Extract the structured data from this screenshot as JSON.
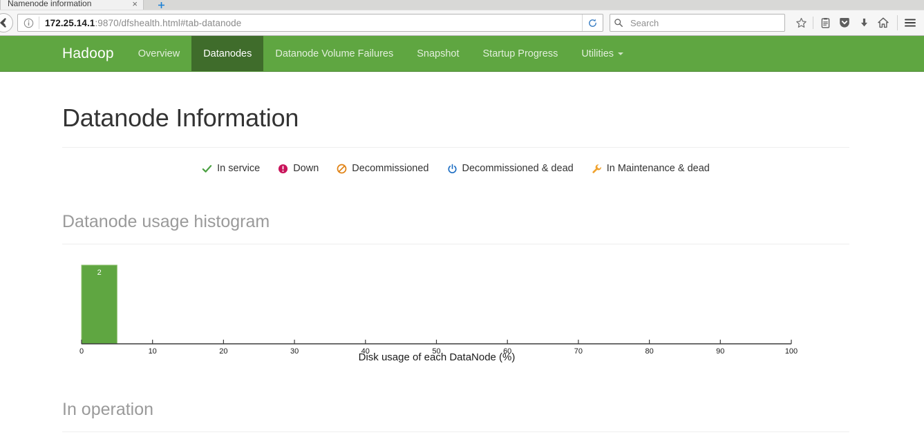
{
  "browser": {
    "tab_title": "Namenode information",
    "tab_close_label": "×",
    "new_tab_label": "+",
    "url_host": "172.25.14.1",
    "url_rest": ":9870/dfshealth.html#tab-datanode",
    "search_placeholder": "Search",
    "icons": {
      "back": "back-arrow-icon",
      "identity": "info-icon",
      "reload": "reload-icon",
      "search": "search-icon",
      "bookmark": "star-icon",
      "reader_list": "reading-list-icon",
      "pocket": "pocket-shield-icon",
      "downloads": "download-arrow-icon",
      "home": "home-icon",
      "menu": "hamburger-menu-icon"
    }
  },
  "hadoop_nav": {
    "brand": "Hadoop",
    "items": [
      {
        "label": "Overview",
        "active": false
      },
      {
        "label": "Datanodes",
        "active": true
      },
      {
        "label": "Datanode Volume Failures",
        "active": false
      },
      {
        "label": "Snapshot",
        "active": false
      },
      {
        "label": "Startup Progress",
        "active": false
      },
      {
        "label": "Utilities",
        "active": false,
        "dropdown": true
      }
    ]
  },
  "main": {
    "page_title": "Datanode Information",
    "histogram_heading": "Datanode usage histogram",
    "in_operation_heading": "In operation"
  },
  "legend": [
    {
      "icon": "check-icon",
      "label": "In service",
      "color": "#4ca143"
    },
    {
      "icon": "exclamation-circle-icon",
      "label": "Down",
      "color": "#c9145b"
    },
    {
      "icon": "ban-circle-icon",
      "label": "Decommissioned",
      "color": "#e08214"
    },
    {
      "icon": "power-icon",
      "label": "Decommissioned & dead",
      "color": "#1f6fc4"
    },
    {
      "icon": "wrench-icon",
      "label": "In Maintenance & dead",
      "color": "#f0a22e"
    }
  ],
  "chart_data": {
    "type": "bar",
    "title": "Datanode usage histogram",
    "xlabel": "Disk usage of each DataNode (%)",
    "ylabel": "",
    "xlim": [
      0,
      100
    ],
    "ylim": [
      0,
      2
    ],
    "grid": false,
    "legend": "none",
    "bar_color": "#5fa641",
    "bar_border_color": "#8fc070",
    "tick_labels": [
      "0",
      "10",
      "20",
      "30",
      "40",
      "50",
      "60",
      "70",
      "80",
      "90",
      "100"
    ],
    "ticks": [
      0,
      10,
      20,
      30,
      40,
      50,
      60,
      70,
      80,
      90,
      100
    ],
    "bins": [
      {
        "x0": 0,
        "x1": 5,
        "value": 2,
        "label": "2"
      }
    ],
    "categories": [
      "0-5"
    ],
    "values": [
      2
    ]
  }
}
